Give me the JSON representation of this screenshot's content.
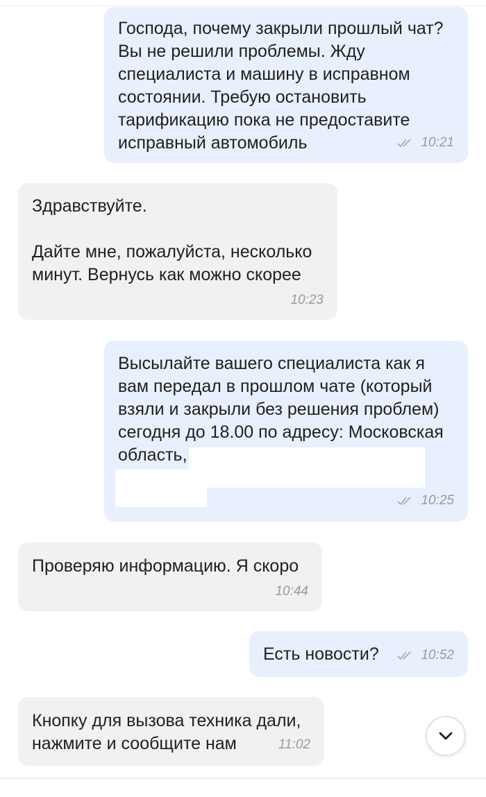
{
  "messages": [
    {
      "direction": "out",
      "text": "Господа, почему закрыли прошлый чат?\nВы не решили проблемы. Жду\nспециалиста и машину в исправном\nсостоянии. Требую остановить\nтарификацию пока не предоставите\nисправный автомобиль",
      "time": "10:21",
      "status_icon": "double-check-icon"
    },
    {
      "direction": "in",
      "text": "Здравствуйте.\n\nДайте мне, пожалуйста, несколько\nминут. Вернусь как можно скорее",
      "time": "10:23"
    },
    {
      "direction": "out",
      "text": "Высылайте вашего специалиста как я\nвам передал в прошлом чате (который\nвзяли и закрыли без решения проблем)\nсегодня до 18.00 по адресу: Московская\nобласть,",
      "time": "10:25",
      "status_icon": "double-check-icon"
    },
    {
      "direction": "in",
      "text": "Проверяю информацию. Я скоро",
      "time": "10:44"
    },
    {
      "direction": "out",
      "text": "Есть новости?",
      "time": "10:52",
      "status_icon": "double-check-icon"
    },
    {
      "direction": "in",
      "text": "Кнопку для вызова техника дали,\nнажмите и сообщите нам",
      "time": "11:02"
    }
  ],
  "scroll_button_icon": "chevron-down-icon",
  "colors": {
    "outgoing_bubble": "#e9f0fd",
    "incoming_bubble": "#f1f1f1",
    "text": "#21201f",
    "time": "#9a9a9a"
  }
}
